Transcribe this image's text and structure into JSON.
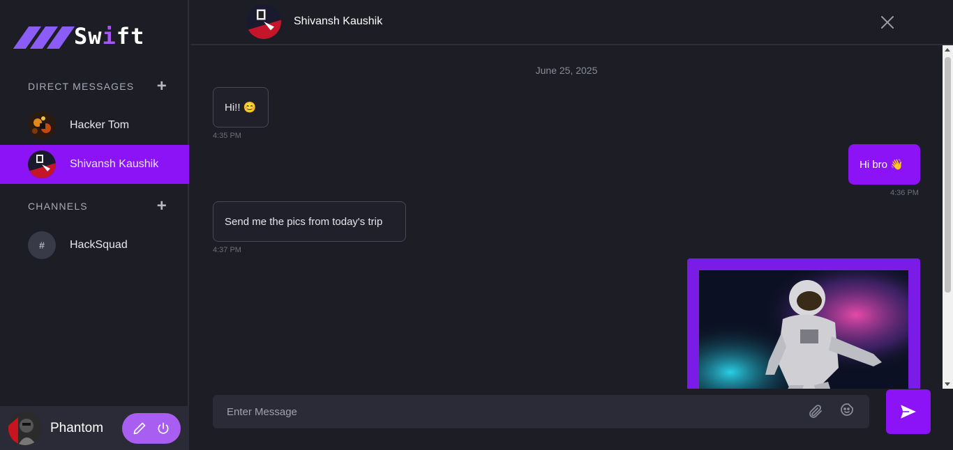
{
  "app": {
    "logo_text_1": "Sw",
    "logo_text_accent": "i",
    "logo_text_2": "ft"
  },
  "sidebar": {
    "direct_messages_label": "DIRECT MESSAGES",
    "channels_label": "CHANNELS",
    "contacts": [
      {
        "name": "Hacker Tom"
      },
      {
        "name": "Shivansh Kaushik",
        "active": true
      }
    ],
    "channels": [
      {
        "icon": "#",
        "name": "HackSquad"
      }
    ]
  },
  "profile": {
    "name": "Phantom"
  },
  "chat": {
    "title": "Shivansh Kaushik",
    "date": "June 25, 2025",
    "messages": [
      {
        "text": "Hi!! 😊",
        "time": "4:35 PM",
        "direction": "in"
      },
      {
        "text": "Hi bro 👋",
        "time": "4:36 PM",
        "direction": "out"
      },
      {
        "text": "Send me the pics from today's trip",
        "time": "4:37 PM",
        "direction": "in"
      }
    ]
  },
  "composer": {
    "placeholder": "Enter Message"
  },
  "colors": {
    "accent": "#8b13f6",
    "background": "#1c1d25",
    "panel": "#2a2b36"
  }
}
